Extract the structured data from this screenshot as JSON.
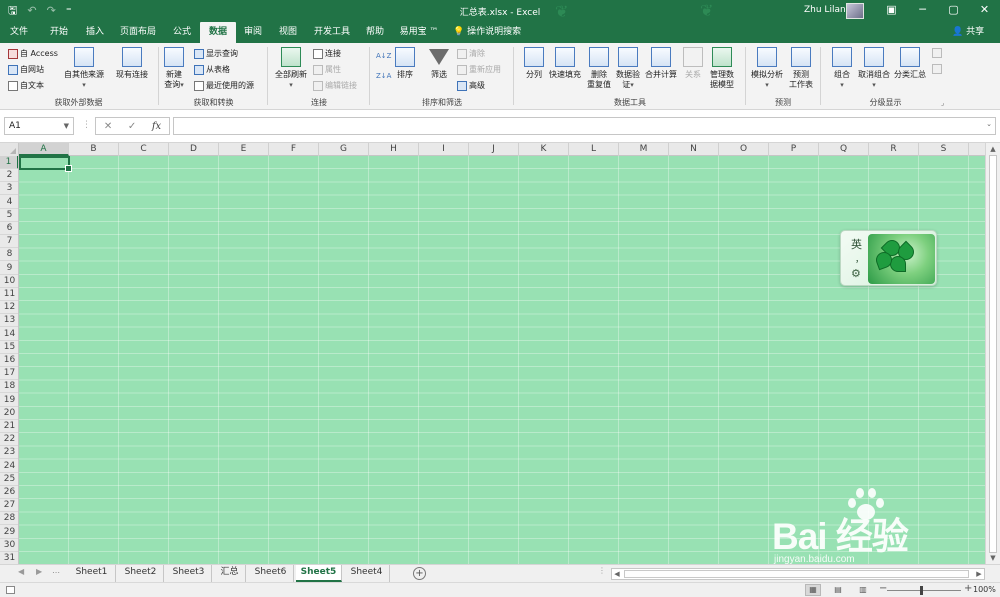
{
  "titlebar": {
    "quick_access": {
      "save_glyph": "🖫",
      "undo_glyph": "↶",
      "redo_glyph": "↷",
      "customize_glyph": "⁼"
    },
    "document_title": "汇总表.xlsx  -  Excel",
    "user_name": "Zhu Lilan",
    "window_buttons": {
      "ribbon_options": "▣",
      "minimize": "─",
      "restore": "▢",
      "close": "✕"
    }
  },
  "ribbon_tabs": [
    "文件",
    "开始",
    "插入",
    "页面布局",
    "公式",
    "数据",
    "审阅",
    "视图",
    "开发工具",
    "帮助",
    "易用宝 ™"
  ],
  "active_tab": "数据",
  "tell_me": "操作说明搜索",
  "share": "共享",
  "ribbon": {
    "get_external": {
      "label": "获取外部数据",
      "access": "自 Access",
      "web": "自网站",
      "text": "自文本",
      "other_sources": "自其他来源",
      "existing": "现有连接"
    },
    "get_transform": {
      "label": "获取和转换",
      "new_query_line1": "新建",
      "new_query_line2": "查询",
      "show_queries": "显示查询",
      "from_table": "从表格",
      "recent_sources": "最近使用的源"
    },
    "connections": {
      "label": "连接",
      "refresh_all": "全部刷新",
      "connections": "连接",
      "properties": "属性",
      "edit_links": "编辑链接"
    },
    "sort_filter": {
      "label": "排序和筛选",
      "sort_az": "A↓Z",
      "sort_za": "Z↓A",
      "sort": "排序",
      "filter": "筛选",
      "clear": "清除",
      "reapply": "重新应用",
      "advanced": "高级"
    },
    "data_tools": {
      "label": "数据工具",
      "text_to_columns": "分列",
      "flash_fill": "快速填充",
      "remove_dup_line1": "删除",
      "remove_dup_line2": "重复值",
      "validation_line1": "数据验",
      "validation_line2": "证",
      "consolidate": "合并计算",
      "relationships": "关系",
      "data_model_line1": "管理数",
      "data_model_line2": "据模型"
    },
    "forecast": {
      "label": "预测",
      "what_if": "模拟分析",
      "forecast_sheet_line1": "预测",
      "forecast_sheet_line2": "工作表"
    },
    "outline": {
      "label": "分级显示",
      "group": "组合",
      "ungroup": "取消组合",
      "subtotal": "分类汇总"
    }
  },
  "formula_bar": {
    "name_box": "A1",
    "cancel_glyph": "✕",
    "enter_glyph": "✓",
    "fx": "fx",
    "formula": ""
  },
  "columns": [
    "A",
    "B",
    "C",
    "D",
    "E",
    "F",
    "G",
    "H",
    "I",
    "J",
    "K",
    "L",
    "M",
    "N",
    "O",
    "P",
    "Q",
    "R",
    "S"
  ],
  "rows": [
    "1",
    "2",
    "3",
    "4",
    "5",
    "6",
    "7",
    "8",
    "9",
    "10",
    "11",
    "12",
    "13",
    "14",
    "15",
    "16",
    "17",
    "18",
    "19",
    "20",
    "21",
    "22",
    "23",
    "24",
    "25",
    "26",
    "27",
    "28",
    "29",
    "30",
    "31"
  ],
  "selected_cell": {
    "column": "A",
    "row": "1"
  },
  "cell_fill_color": "#98e1b3",
  "accent_color": "#217346",
  "ime": {
    "char": "英",
    "punct": "，",
    "gear": "⚙"
  },
  "sheet_tabs": [
    "Sheet1",
    "Sheet2",
    "Sheet3",
    "汇总",
    "Sheet6",
    "Sheet5",
    "Sheet4"
  ],
  "active_sheet": "Sheet5",
  "status": {
    "zoom": "100%"
  },
  "watermark": {
    "brand": "Bai  经验",
    "url": "jingyan.baidu.com"
  }
}
